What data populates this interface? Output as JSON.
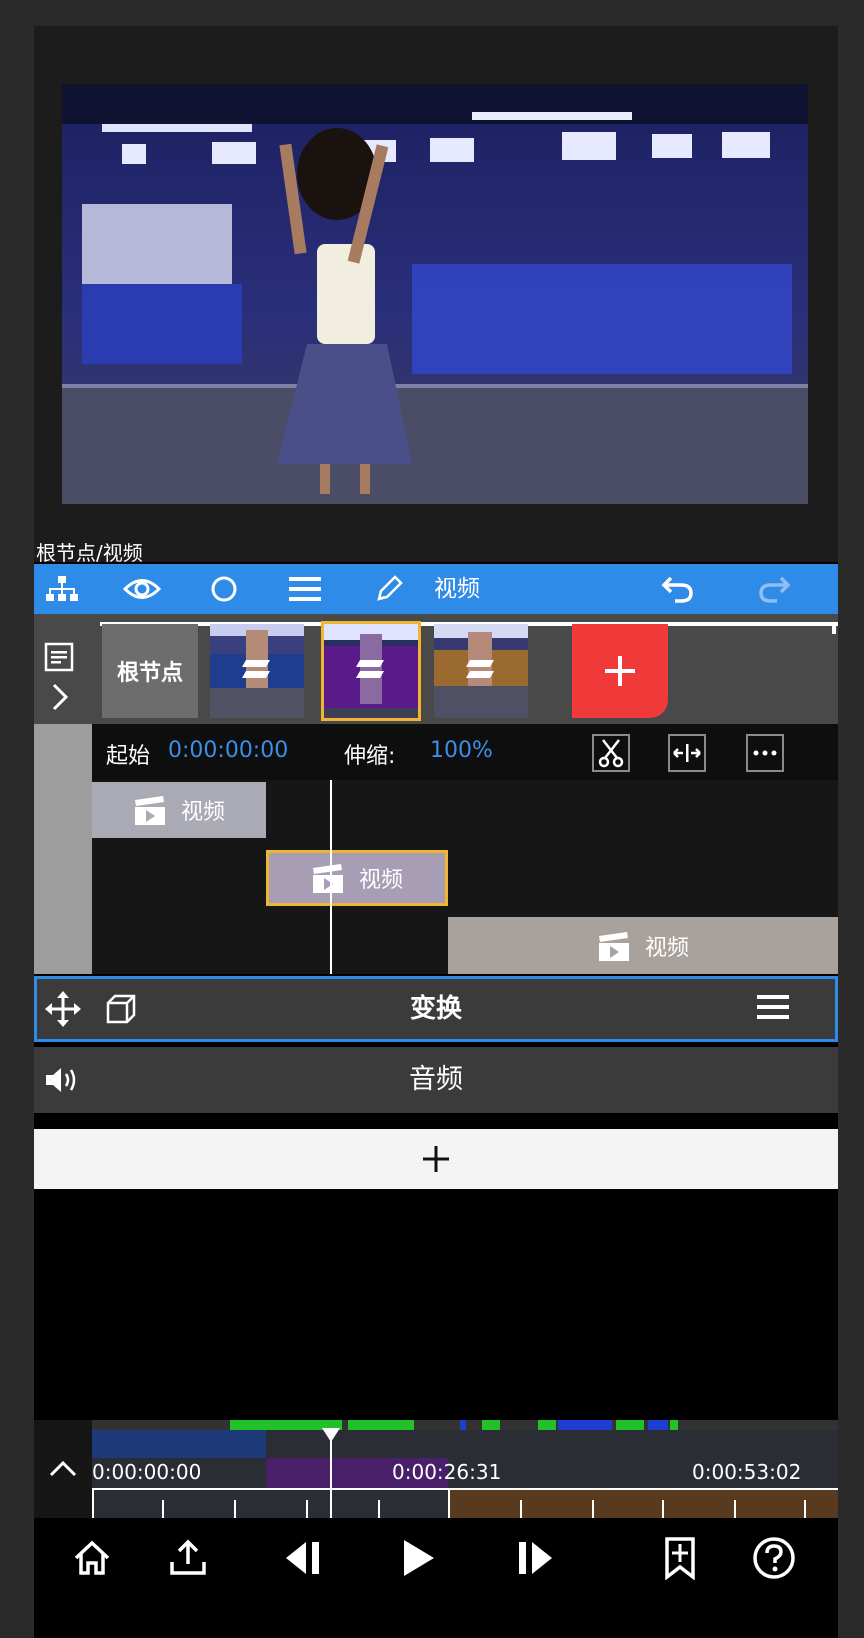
{
  "breadcrumb": "根节点/视频",
  "toolbar": {
    "current_layer_label": "视频",
    "icons": [
      "hierarchy-icon",
      "eye-icon",
      "circle-icon",
      "menu-icon",
      "pencil-icon",
      "undo-icon",
      "redo-icon"
    ]
  },
  "layers": {
    "root_label": "根节点",
    "thumbnails": [
      "video-thumb-1",
      "video-thumb-2",
      "video-thumb-3"
    ],
    "selected_index": 1,
    "add_icon": "plus-icon"
  },
  "timeline": {
    "start_label": "起始",
    "start_value": "0:00:00:00",
    "scale_label": "伸缩:",
    "scale_value": "100%",
    "clips": [
      {
        "label": "视频"
      },
      {
        "label": "视频"
      },
      {
        "label": "视频"
      }
    ]
  },
  "transform": {
    "title": "变换"
  },
  "audio": {
    "title": "音频"
  },
  "add_track": {
    "icon": "plus-icon"
  },
  "overview": {
    "time_start": "0:00:00:00",
    "time_mid": "0:00:26:31",
    "time_end": "0:00:53:02"
  },
  "bottom_bar": {
    "icons": [
      "home-icon",
      "export-icon",
      "prev-frame-icon",
      "play-icon",
      "next-frame-icon",
      "bookmark-icon",
      "help-icon"
    ]
  },
  "colors": {
    "accent_blue": "#2f8be8",
    "selected_outline": "#f0b632",
    "add_red": "#f03a3a",
    "green_marker": "#22c02a"
  }
}
